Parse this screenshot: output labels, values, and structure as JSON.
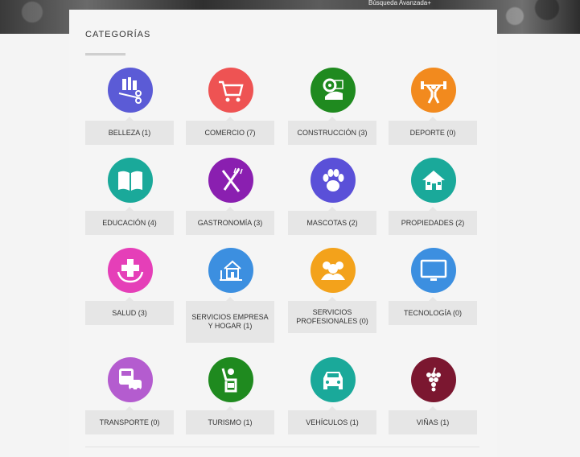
{
  "header": {
    "advanced_search": "Búsqueda Avanzada+"
  },
  "section": {
    "title": "CATEGORÍAS"
  },
  "categories": [
    {
      "label": "BELLEZA (1)",
      "color": "#5b5bd6",
      "icon": "beauty-icon"
    },
    {
      "label": "COMERCIO (7)",
      "color": "#ee5353",
      "icon": "shopping-cart-icon"
    },
    {
      "label": "CONSTRUCCIÓN (3)",
      "color": "#1f8a1f",
      "icon": "construction-icon"
    },
    {
      "label": "DEPORTE (0)",
      "color": "#f28a1e",
      "icon": "weightlifter-icon"
    },
    {
      "label": "EDUCACIÓN (4)",
      "color": "#1aa99a",
      "icon": "book-icon"
    },
    {
      "label": "GASTRONOMÍA (3)",
      "color": "#8a1fb0",
      "icon": "fork-knife-icon"
    },
    {
      "label": "MASCOTAS (2)",
      "color": "#5a50d8",
      "icon": "paw-icon"
    },
    {
      "label": "PROPIEDADES (2)",
      "color": "#1aa99a",
      "icon": "house-icon"
    },
    {
      "label": "SALUD (3)",
      "color": "#e53fb8",
      "icon": "health-cross-icon"
    },
    {
      "label": "SERVICIOS EMPRESA Y HOGAR (1)",
      "color": "#3c8fe0",
      "icon": "home-service-icon"
    },
    {
      "label": "SERVICIOS PROFESIONALES (0)",
      "color": "#f3a21b",
      "icon": "group-icon"
    },
    {
      "label": "TECNOLOGÍA (0)",
      "color": "#3c8fe0",
      "icon": "monitor-icon"
    },
    {
      "label": "TRANSPORTE (0)",
      "color": "#b45ccf",
      "icon": "bus-icon"
    },
    {
      "label": "TURISMO (1)",
      "color": "#1f8a1f",
      "icon": "tourist-icon"
    },
    {
      "label": "VEHÍCULOS (1)",
      "color": "#1aa99a",
      "icon": "car-icon"
    },
    {
      "label": "VIÑAS (1)",
      "color": "#7b1730",
      "icon": "grapes-icon"
    }
  ]
}
